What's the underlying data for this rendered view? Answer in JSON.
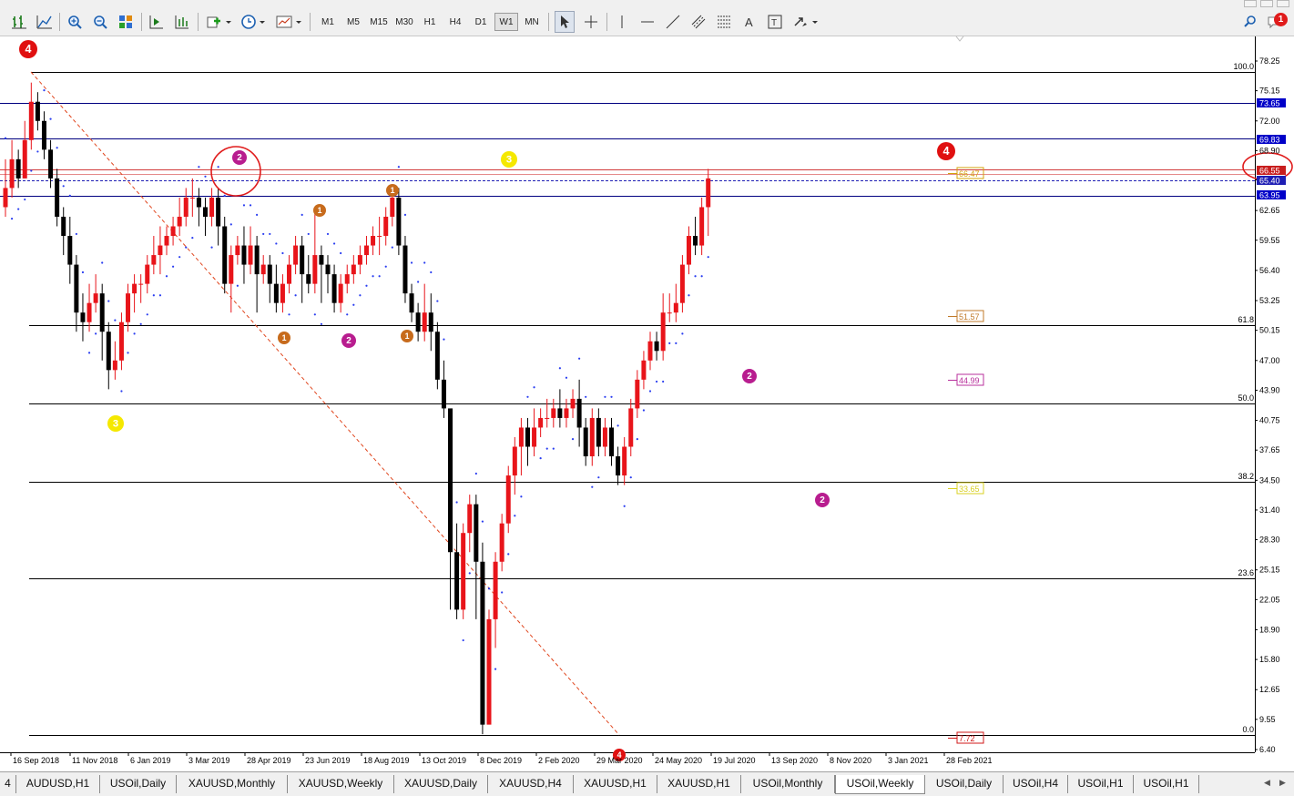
{
  "toolbar": {
    "timeframes": [
      "M1",
      "M5",
      "M15",
      "M30",
      "H1",
      "H4",
      "D1",
      "W1",
      "MN"
    ],
    "active_timeframe": "W1",
    "notification_count": "1"
  },
  "chart": {
    "symbol_timeframe": "USOil,Weekly",
    "price_axis": [
      "78.25",
      "75.15",
      "72.00",
      "68.90",
      "65.85",
      "62.65",
      "59.55",
      "56.40",
      "53.25",
      "50.15",
      "47.00",
      "43.90",
      "40.75",
      "37.65",
      "34.50",
      "31.40",
      "28.30",
      "25.15",
      "22.05",
      "18.90",
      "15.80",
      "12.65",
      "9.55",
      "6.40"
    ],
    "price_tags": [
      {
        "text": "73.65",
        "color": "#0000c8"
      },
      {
        "text": "69.83",
        "color": "#0000c8"
      },
      {
        "text": "66.55",
        "color": "#c81e1e"
      },
      {
        "text": "65.40",
        "color": "#1e1eb4"
      },
      {
        "text": "63.95",
        "color": "#0000c8"
      }
    ],
    "date_axis": [
      "16 Sep 2018",
      "11 Nov 2018",
      "6 Jan 2019",
      "3 Mar 2019",
      "28 Apr 2019",
      "23 Jun 2019",
      "18 Aug 2019",
      "13 Oct 2019",
      "8 Dec 2019",
      "2 Feb 2020",
      "29 Mar 2020",
      "24 May 2020",
      "19 Jul 2020",
      "13 Sep 2020",
      "8 Nov 2020",
      "3 Jan 2021",
      "28 Feb 2021"
    ],
    "fib_levels": [
      "100.0",
      "61.8",
      "50.0",
      "38.2",
      "23.6",
      "0.0"
    ],
    "fib_boxes": [
      {
        "text": "66.47",
        "color": "#d4a20a"
      },
      {
        "text": "51.57",
        "color": "#c07a2a"
      },
      {
        "text": "44.99",
        "color": "#b8309c"
      },
      {
        "text": "33.65",
        "color": "#d8d020"
      },
      {
        "text": "7.72",
        "color": "#d01818"
      }
    ],
    "wave_labels": [
      {
        "text": "4",
        "color": "#e01010"
      },
      {
        "text": "4",
        "color": "#e01010"
      },
      {
        "text": "4",
        "color": "#e01010"
      },
      {
        "text": "3",
        "color": "#f5e800"
      },
      {
        "text": "3",
        "color": "#f5e800"
      },
      {
        "text": "2",
        "color": "#b81d8f"
      },
      {
        "text": "2",
        "color": "#b81d8f"
      },
      {
        "text": "2",
        "color": "#b81d8f"
      },
      {
        "text": "2",
        "color": "#b81d8f"
      },
      {
        "text": "1",
        "color": "#c76b1c"
      },
      {
        "text": "1",
        "color": "#c76b1c"
      },
      {
        "text": "1",
        "color": "#c76b1c"
      },
      {
        "text": "1",
        "color": "#c76b1c"
      }
    ],
    "candles": [
      [
        63,
        65,
        62,
        68
      ],
      [
        65,
        68,
        64,
        70
      ],
      [
        68,
        66,
        65,
        69
      ],
      [
        66,
        70,
        66,
        72
      ],
      [
        70,
        74,
        69,
        76
      ],
      [
        74,
        72,
        71,
        75
      ],
      [
        72,
        69,
        68,
        73
      ],
      [
        69,
        66,
        65,
        70
      ],
      [
        66,
        62,
        61,
        67
      ],
      [
        62,
        60,
        58,
        63
      ],
      [
        60,
        57,
        55,
        62
      ],
      [
        57,
        52,
        50,
        58
      ],
      [
        52,
        51,
        49,
        54
      ],
      [
        51,
        53,
        50,
        55
      ],
      [
        53,
        54,
        52,
        56
      ],
      [
        54,
        50,
        47,
        55
      ],
      [
        50,
        46,
        44,
        51
      ],
      [
        46,
        47,
        45,
        49
      ],
      [
        47,
        51,
        46,
        52
      ],
      [
        51,
        54,
        50,
        55
      ],
      [
        54,
        55,
        52,
        56
      ],
      [
        55,
        55,
        53,
        56
      ],
      [
        55,
        57,
        54,
        58
      ],
      [
        57,
        58,
        56,
        60
      ],
      [
        58,
        59,
        56,
        61
      ],
      [
        59,
        60,
        58,
        61
      ],
      [
        60,
        61,
        59,
        62
      ],
      [
        61,
        62,
        60,
        64
      ],
      [
        62,
        64,
        61,
        65
      ],
      [
        64,
        64,
        62,
        66
      ],
      [
        64,
        63,
        61,
        65
      ],
      [
        63,
        62,
        60,
        64
      ],
      [
        62,
        64,
        61,
        65
      ],
      [
        64,
        61,
        59,
        65
      ],
      [
        61,
        55,
        54,
        62
      ],
      [
        55,
        58,
        52,
        59
      ],
      [
        58,
        59,
        57,
        60
      ],
      [
        59,
        57,
        55,
        61
      ],
      [
        57,
        59,
        56,
        61
      ],
      [
        59,
        56,
        52,
        60
      ],
      [
        56,
        57,
        55,
        58
      ],
      [
        57,
        55,
        53,
        58
      ],
      [
        55,
        53,
        52,
        57
      ],
      [
        53,
        55,
        52,
        56
      ],
      [
        55,
        57,
        54,
        58
      ],
      [
        57,
        59,
        56,
        60
      ],
      [
        59,
        56,
        53,
        60
      ],
      [
        56,
        55,
        54,
        58
      ],
      [
        55,
        58,
        54,
        63
      ],
      [
        58,
        57,
        53,
        59
      ],
      [
        57,
        56,
        54,
        58
      ],
      [
        56,
        53,
        52,
        57
      ],
      [
        53,
        55,
        52,
        56
      ],
      [
        55,
        56,
        54,
        57
      ],
      [
        56,
        57,
        55,
        58
      ],
      [
        57,
        58,
        56,
        59
      ],
      [
        58,
        59,
        57,
        60
      ],
      [
        59,
        60,
        58,
        61
      ],
      [
        60,
        60,
        58,
        62
      ],
      [
        60,
        62,
        59,
        63
      ],
      [
        62,
        64,
        61,
        65
      ],
      [
        64,
        59,
        58,
        65
      ],
      [
        59,
        54,
        53,
        60
      ],
      [
        54,
        52,
        51,
        55
      ],
      [
        52,
        50,
        49,
        53
      ],
      [
        50,
        52,
        49,
        55
      ],
      [
        52,
        50,
        48,
        54
      ],
      [
        50,
        45,
        44,
        51
      ],
      [
        45,
        42,
        41,
        47
      ],
      [
        42,
        27,
        21,
        37
      ],
      [
        27,
        21,
        20,
        30
      ],
      [
        21,
        29,
        20,
        30
      ],
      [
        29,
        32,
        27,
        33
      ],
      [
        32,
        26,
        20,
        33
      ],
      [
        26,
        9,
        8,
        28
      ],
      [
        9,
        20,
        13,
        21
      ],
      [
        20,
        26,
        17,
        27
      ],
      [
        26,
        30,
        25,
        31
      ],
      [
        30,
        35,
        29,
        36
      ],
      [
        35,
        38,
        33,
        39
      ],
      [
        38,
        40,
        35,
        41
      ],
      [
        40,
        38,
        36,
        41
      ],
      [
        38,
        40,
        37,
        42
      ],
      [
        40,
        41,
        39,
        42
      ],
      [
        41,
        41,
        40,
        43
      ],
      [
        41,
        42,
        40,
        43
      ],
      [
        42,
        41,
        40,
        44
      ],
      [
        41,
        42,
        40,
        43
      ],
      [
        42,
        43,
        41,
        44
      ],
      [
        43,
        40,
        38,
        45
      ],
      [
        40,
        37,
        36,
        41
      ],
      [
        37,
        41,
        36,
        42
      ],
      [
        41,
        38,
        37,
        42
      ],
      [
        38,
        40,
        37,
        41
      ],
      [
        40,
        37,
        36,
        41
      ],
      [
        37,
        35,
        34,
        38
      ],
      [
        35,
        38,
        34,
        39
      ],
      [
        38,
        42,
        37,
        43
      ],
      [
        42,
        45,
        41,
        46
      ],
      [
        45,
        47,
        44,
        48
      ],
      [
        47,
        49,
        46,
        50
      ],
      [
        49,
        48,
        47,
        50
      ],
      [
        48,
        52,
        47,
        54
      ],
      [
        52,
        52,
        51,
        54
      ],
      [
        52,
        53,
        51,
        55
      ],
      [
        53,
        57,
        52,
        58
      ],
      [
        57,
        60,
        56,
        61
      ],
      [
        60,
        59,
        58,
        62
      ],
      [
        59,
        63,
        58,
        64
      ],
      [
        63,
        66,
        60,
        67
      ]
    ]
  }
}
